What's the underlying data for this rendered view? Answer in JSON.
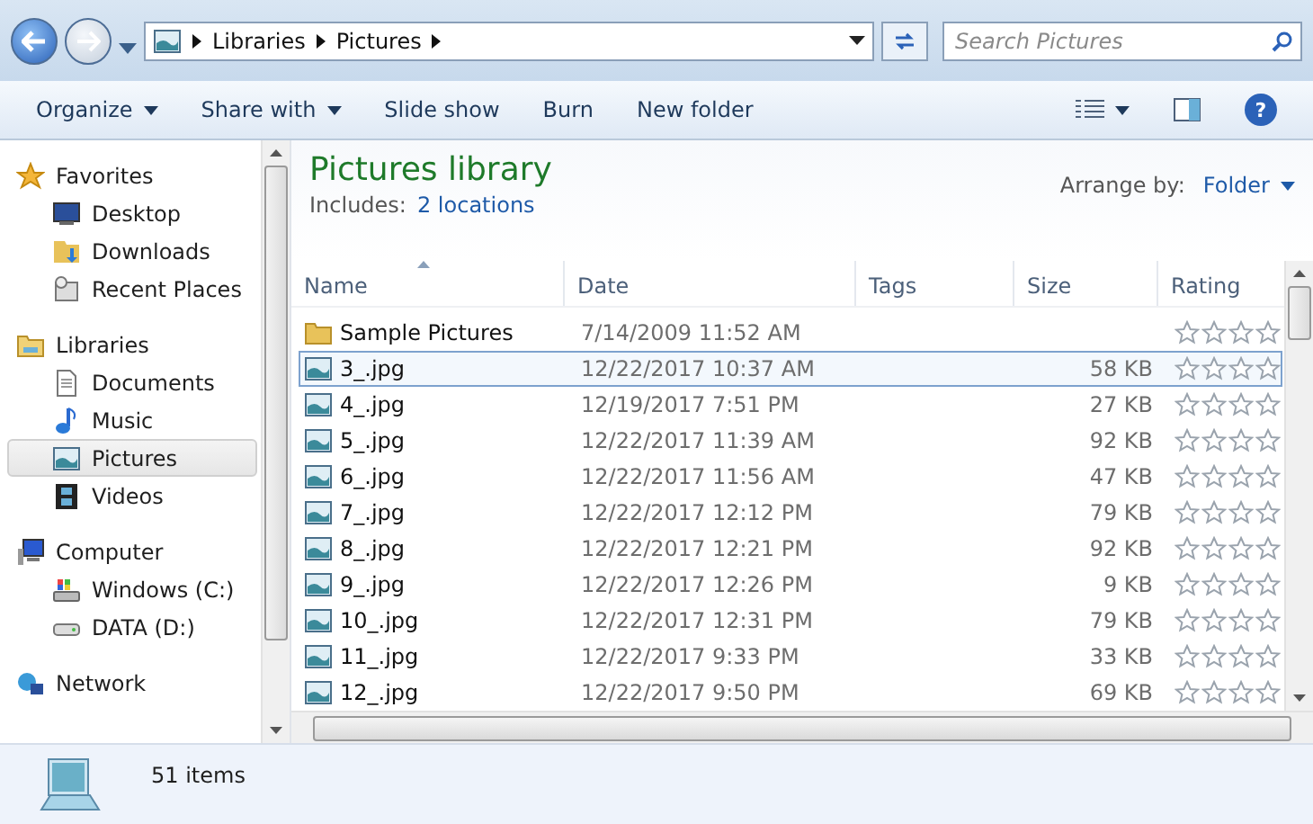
{
  "address": {
    "crumbs": [
      "Libraries",
      "Pictures"
    ]
  },
  "search": {
    "placeholder": "Search Pictures"
  },
  "toolbar": [
    {
      "label": "Organize",
      "dropdown": true
    },
    {
      "label": "Share with",
      "dropdown": true
    },
    {
      "label": "Slide show",
      "dropdown": false
    },
    {
      "label": "Burn",
      "dropdown": false
    },
    {
      "label": "New folder",
      "dropdown": false
    }
  ],
  "sidebar": {
    "sections": [
      {
        "label": "Favorites",
        "kind": "favorites",
        "children": [
          {
            "label": "Desktop",
            "kind": "desktop",
            "selected": false
          },
          {
            "label": "Downloads",
            "kind": "downloads",
            "selected": false
          },
          {
            "label": "Recent Places",
            "kind": "recent",
            "selected": false
          }
        ]
      },
      {
        "label": "Libraries",
        "kind": "libraries",
        "children": [
          {
            "label": "Documents",
            "kind": "documents",
            "selected": false
          },
          {
            "label": "Music",
            "kind": "music",
            "selected": false
          },
          {
            "label": "Pictures",
            "kind": "pictures",
            "selected": true
          },
          {
            "label": "Videos",
            "kind": "videos",
            "selected": false
          }
        ]
      },
      {
        "label": "Computer",
        "kind": "computer",
        "children": [
          {
            "label": "Windows (C:)",
            "kind": "sysdrive",
            "selected": false
          },
          {
            "label": "DATA (D:)",
            "kind": "drive",
            "selected": false
          }
        ]
      },
      {
        "label": "Network",
        "kind": "network"
      }
    ]
  },
  "library": {
    "title": "Pictures library",
    "includes_label": "Includes:",
    "includes_link": "2 locations",
    "arrange_label": "Arrange by:",
    "arrange_value": "Folder"
  },
  "table": {
    "columns": [
      "Name",
      "Date",
      "Tags",
      "Size",
      "Rating"
    ],
    "rows": [
      {
        "kind": "folder",
        "name": "Sample Pictures",
        "date": "7/14/2009 11:52 AM",
        "size": "",
        "stars": 0,
        "selected": false
      },
      {
        "kind": "image",
        "name": "3_.jpg",
        "date": "12/22/2017 10:37 AM",
        "size": "58 KB",
        "stars": 0,
        "selected": true
      },
      {
        "kind": "image",
        "name": "4_.jpg",
        "date": "12/19/2017 7:51 PM",
        "size": "27 KB",
        "stars": 0,
        "selected": false
      },
      {
        "kind": "image",
        "name": "5_.jpg",
        "date": "12/22/2017 11:39 AM",
        "size": "92 KB",
        "stars": 0,
        "selected": false
      },
      {
        "kind": "image",
        "name": "6_.jpg",
        "date": "12/22/2017 11:56 AM",
        "size": "47 KB",
        "stars": 0,
        "selected": false
      },
      {
        "kind": "image",
        "name": "7_.jpg",
        "date": "12/22/2017 12:12 PM",
        "size": "79 KB",
        "stars": 0,
        "selected": false
      },
      {
        "kind": "image",
        "name": "8_.jpg",
        "date": "12/22/2017 12:21 PM",
        "size": "92 KB",
        "stars": 0,
        "selected": false
      },
      {
        "kind": "image",
        "name": "9_.jpg",
        "date": "12/22/2017 12:26 PM",
        "size": "9 KB",
        "stars": 0,
        "selected": false
      },
      {
        "kind": "image",
        "name": "10_.jpg",
        "date": "12/22/2017 12:31 PM",
        "size": "79 KB",
        "stars": 0,
        "selected": false
      },
      {
        "kind": "image",
        "name": "11_.jpg",
        "date": "12/22/2017 9:33 PM",
        "size": "33 KB",
        "stars": 0,
        "selected": false
      },
      {
        "kind": "image",
        "name": "12_.jpg",
        "date": "12/22/2017 9:50 PM",
        "size": "69 KB",
        "stars": 0,
        "selected": false
      }
    ]
  },
  "help_button": {
    "glyph": "?"
  },
  "status_bar": {
    "count": "51 items"
  }
}
